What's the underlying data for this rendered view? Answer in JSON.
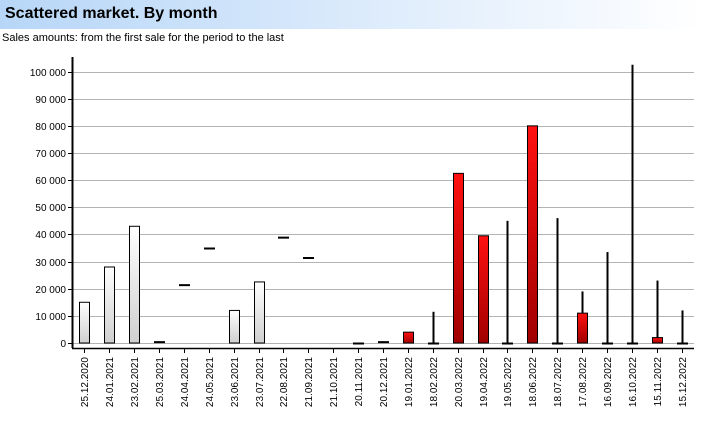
{
  "header": {
    "title": "Scattered market. By month",
    "subtitle": "Sales amounts: from the first sale for the period to the last"
  },
  "chart_data": {
    "type": "candlestick",
    "ylim": [
      0,
      105000
    ],
    "yticks": [
      0,
      10000,
      20000,
      30000,
      40000,
      50000,
      60000,
      70000,
      80000,
      90000,
      100000
    ],
    "ytick_labels": [
      "0",
      "10 000",
      "20 000",
      "30 000",
      "40 000",
      "50 000",
      "60 000",
      "70 000",
      "80 000",
      "90 000",
      "100 000"
    ],
    "grid": true,
    "colors": {
      "up": "#ffffff",
      "down": "#dd0000",
      "grid": "#b4b4b4",
      "axis": "#000000"
    },
    "categories": [
      "25.12.2020",
      "24.01.2021",
      "23.02.2021",
      "25.03.2021",
      "24.04.2021",
      "24.05.2021",
      "23.06.2021",
      "23.07.2021",
      "22.08.2021",
      "21.09.2021",
      "21.10.2021",
      "20.11.2021",
      "20.12.2021",
      "19.01.2022",
      "18.02.2022",
      "20.03.2022",
      "19.04.2022",
      "19.05.2022",
      "18.06.2022",
      "18.07.2022",
      "17.08.2022",
      "16.09.2022",
      "16.10.2022",
      "15.11.2022",
      "15.12.2022"
    ],
    "candles": [
      {
        "open": 0,
        "close": 15000,
        "low": 0,
        "high": 15000
      },
      {
        "open": 0,
        "close": 28000,
        "low": 0,
        "high": 28000
      },
      {
        "open": 0,
        "close": 43000,
        "low": 0,
        "high": 43000
      },
      {
        "open": 500,
        "close": 500,
        "low": 500,
        "high": 500
      },
      {
        "open": 21500,
        "close": 21500,
        "low": 21500,
        "high": 21500
      },
      {
        "open": 35000,
        "close": 35000,
        "low": 35000,
        "high": 35000
      },
      {
        "open": 0,
        "close": 12000,
        "low": 0,
        "high": 12000
      },
      {
        "open": 0,
        "close": 22500,
        "low": 0,
        "high": 22500
      },
      {
        "open": 39000,
        "close": 39000,
        "low": 39000,
        "high": 39000
      },
      {
        "open": 31500,
        "close": 31500,
        "low": 31500,
        "high": 31500
      },
      null,
      {
        "open": 0,
        "close": 0,
        "low": 0,
        "high": 0
      },
      {
        "open": 500,
        "close": 500,
        "low": 500,
        "high": 500
      },
      {
        "open": 4000,
        "close": 0,
        "low": 0,
        "high": 4000
      },
      {
        "open": 0,
        "close": 0,
        "low": 0,
        "high": 11500
      },
      {
        "open": 62500,
        "close": 0,
        "low": 0,
        "high": 62500
      },
      {
        "open": 39500,
        "close": 0,
        "low": 0,
        "high": 39500
      },
      {
        "open": 0,
        "close": 0,
        "low": 0,
        "high": 45000
      },
      {
        "open": 80000,
        "close": 0,
        "low": 0,
        "high": 80000
      },
      {
        "open": 0,
        "close": 0,
        "low": 0,
        "high": 46000
      },
      {
        "open": 11000,
        "close": 0,
        "low": 0,
        "high": 19000
      },
      {
        "open": 0,
        "close": 0,
        "low": 0,
        "high": 33500
      },
      {
        "open": 0,
        "close": 0,
        "low": 0,
        "high": 102500
      },
      {
        "open": 2000,
        "close": 0,
        "low": 0,
        "high": 23000
      },
      {
        "open": 0,
        "close": 0,
        "low": 0,
        "high": 12000
      }
    ]
  }
}
